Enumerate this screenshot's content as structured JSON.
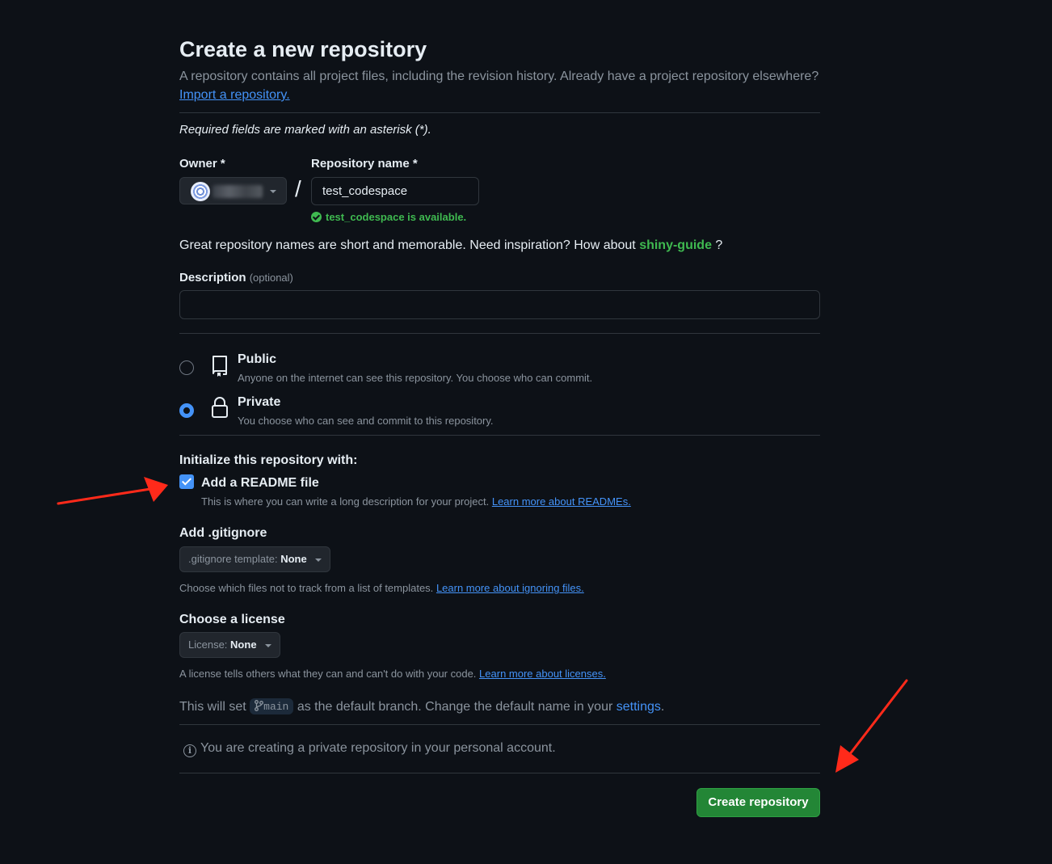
{
  "header": {
    "title": "Create a new repository",
    "subtitle": "A repository contains all project files, including the revision history. Already have a project repository elsewhere?",
    "import_link": "Import a repository."
  },
  "required_note": "Required fields are marked with an asterisk (*).",
  "owner": {
    "label": "Owner *",
    "selected": ""
  },
  "repo_name": {
    "label": "Repository name *",
    "value": "test_codespace",
    "separator": "/",
    "availability": "test_codespace is available."
  },
  "inspiration": {
    "text": "Great repository names are short and memorable. Need inspiration? How about",
    "suggestion": "shiny-guide",
    "suffix": "?"
  },
  "description": {
    "label": "Description",
    "optional": "(optional)",
    "value": ""
  },
  "visibility": {
    "selected": "Private",
    "options": [
      {
        "title": "Public",
        "desc": "Anyone on the internet can see this repository. You choose who can commit.",
        "icon": "repo-icon"
      },
      {
        "title": "Private",
        "desc": "You choose who can see and commit to this repository.",
        "icon": "lock-icon"
      }
    ]
  },
  "initialize": {
    "title": "Initialize this repository with:",
    "readme": {
      "label": "Add a README file",
      "checked": true,
      "desc": "This is where you can write a long description for your project.",
      "link": "Learn more about READMEs."
    }
  },
  "gitignore": {
    "title": "Add .gitignore",
    "prefix": ".gitignore template:",
    "value": "None",
    "desc": "Choose which files not to track from a list of templates.",
    "link": "Learn more about ignoring files."
  },
  "license": {
    "title": "Choose a license",
    "prefix": "License:",
    "value": "None",
    "desc": "A license tells others what they can and can't do with your code.",
    "link": "Learn more about licenses."
  },
  "branch": {
    "before": "This will set",
    "name": "main",
    "after": "as the default branch. Change the default name in your",
    "settings_link": "settings",
    "end": "."
  },
  "notice": "You are creating a private repository in your personal account.",
  "submit": {
    "label": "Create repository"
  },
  "colors": {
    "background": "#0d1117",
    "accent_blue": "#4493f8",
    "success_green": "#3fb950",
    "button_green": "#238636",
    "annotation_red": "#ff2a1a"
  }
}
